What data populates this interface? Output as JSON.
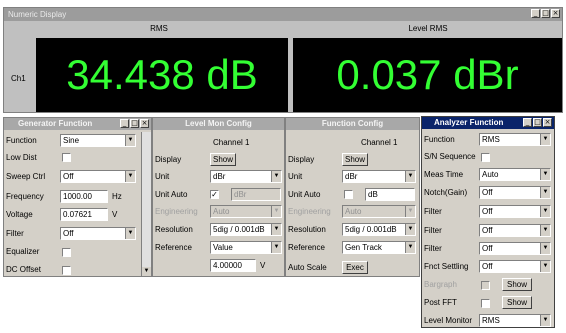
{
  "numeric_display": {
    "title": "Numeric Display",
    "left_label": "RMS",
    "right_label": "Level RMS",
    "channel": "Ch1",
    "left_value": "34.438 dB",
    "right_value": "0.037 dBr"
  },
  "generator": {
    "title": "Generator Function",
    "function_label": "Function",
    "function_value": "Sine",
    "lowdist_label": "Low Dist",
    "sweep_label": "Sweep Ctrl",
    "sweep_value": "Off",
    "freq_label": "Frequency",
    "freq_value": "1000.00",
    "freq_unit": "Hz",
    "volt_label": "Voltage",
    "volt_value": "0.07621",
    "volt_unit": "V",
    "filter_label": "Filter",
    "filter_value": "Off",
    "eq_label": "Equalizer",
    "dc_label": "DC Offset"
  },
  "levelmon": {
    "title": "Level Mon Config",
    "channel": "Channel 1",
    "display_label": "Display",
    "show": "Show",
    "unit_label": "Unit",
    "unit_value": "dBr",
    "unitauto_label": "Unit Auto",
    "unitauto_value": "dBr",
    "eng_label": "Engineering",
    "eng_value": "Auto",
    "res_label": "Resolution",
    "res_value": "5dig / 0.001dB",
    "ref_label": "Reference",
    "ref_value": "Value",
    "ref_num": "4.00000",
    "ref_unit": "V"
  },
  "funcconfig": {
    "title": "Function Config",
    "channel": "Channel 1",
    "display_label": "Display",
    "show": "Show",
    "unit_label": "Unit",
    "unit_value": "dBr",
    "unitauto_label": "Unit Auto",
    "unitauto_value": "dB",
    "eng_label": "Engineering",
    "eng_value": "Auto",
    "res_label": "Resolution",
    "res_value": "5dig / 0.001dB",
    "ref_label": "Reference",
    "ref_value": "Gen Track",
    "autoscale_label": "Auto Scale",
    "exec": "Exec"
  },
  "analyzer": {
    "title": "Analyzer Function",
    "function_label": "Function",
    "function_value": "RMS",
    "sn_label": "S/N Sequence",
    "meas_label": "Meas Time",
    "meas_value": "Auto",
    "notch_label": "Notch(Gain)",
    "notch_value": "Off",
    "filter1_label": "Filter",
    "filter1_value": "Off",
    "filter2_label": "Filter",
    "filter2_value": "Off",
    "filter3_label": "Filter",
    "filter3_value": "Off",
    "fnct_label": "Fnct Settling",
    "fnct_value": "Off",
    "bargraph_label": "Bargraph",
    "bargraph_show": "Show",
    "postfft_label": "Post FFT",
    "postfft_show": "Show",
    "levelmon_label": "Level Monitor",
    "levelmon_value": "RMS"
  },
  "glyphs": {
    "min": "_",
    "max": "□",
    "close": "×",
    "arrow": "▼",
    "check": "✓"
  }
}
